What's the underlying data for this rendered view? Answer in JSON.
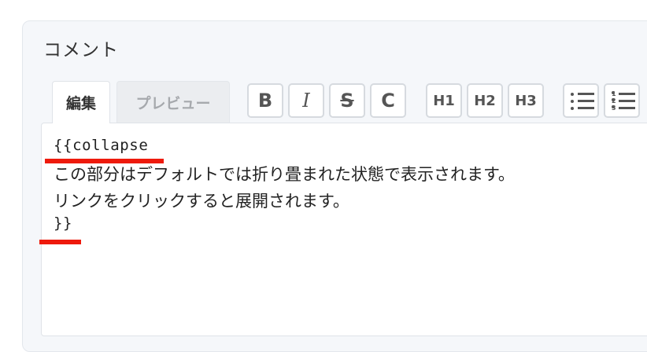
{
  "comment": {
    "title": "コメント"
  },
  "tabs": {
    "edit": "編集",
    "preview": "プレビュー"
  },
  "toolbar": {
    "bold": "B",
    "italic": "I",
    "strike": "S",
    "code": "C",
    "h1": "H1",
    "h2": "H2",
    "h3": "H3",
    "ol_numbers": [
      "1",
      "2",
      "3"
    ]
  },
  "editor": {
    "lines": [
      "{{collapse",
      "この部分はデフォルトでは折り畳まれた状態で表示されます。",
      "リンクをクリックすると展開されます。",
      "}}"
    ]
  },
  "colors": {
    "highlight": "#ee1a0c",
    "panel_bg": "#f5f7fa"
  }
}
